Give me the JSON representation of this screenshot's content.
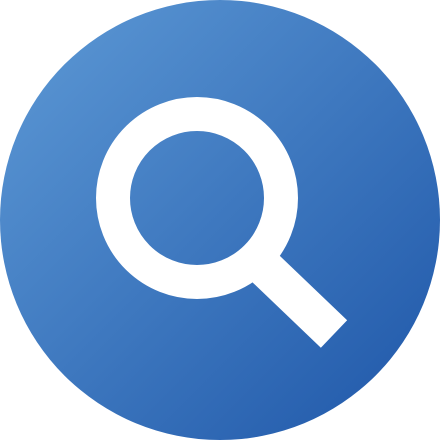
{
  "icon": {
    "name": "search-icon",
    "gradient_start": "#5E9AD6",
    "gradient_end": "#1E56A8",
    "glyph_color": "#FFFFFF"
  }
}
